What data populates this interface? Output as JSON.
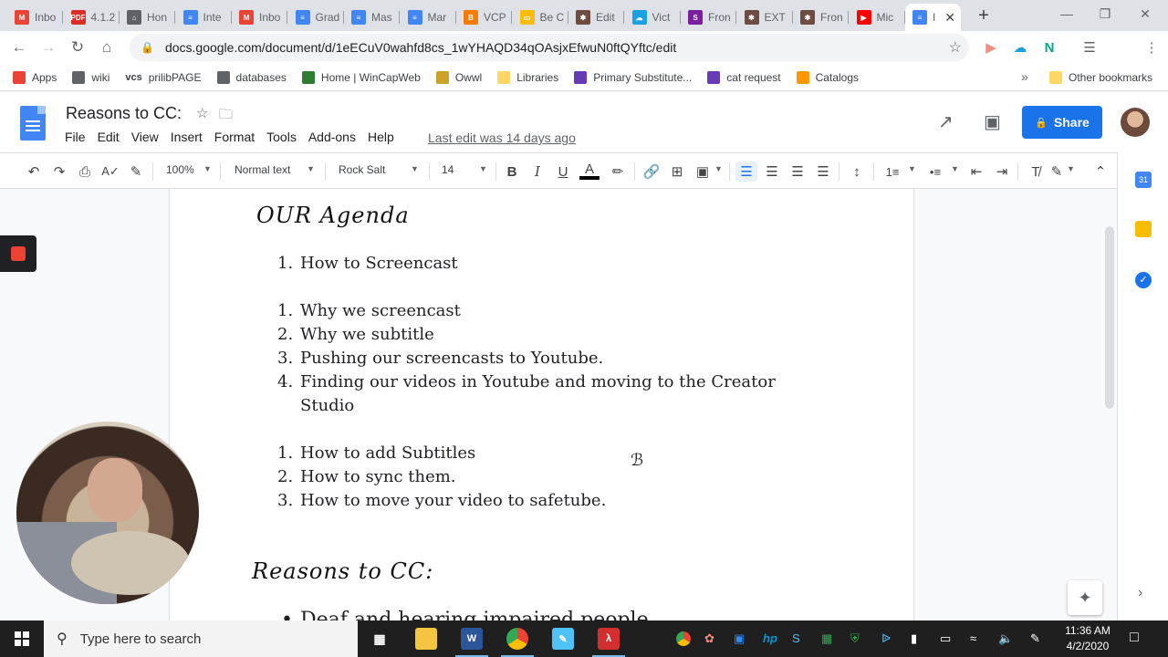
{
  "browser": {
    "tabs": [
      {
        "label": "Inbo",
        "color": "#ea4335",
        "glyph": "M"
      },
      {
        "label": "4.1.2",
        "color": "#d93025",
        "glyph": "PDF"
      },
      {
        "label": "Hon",
        "color": "#5f6368",
        "glyph": "⌂"
      },
      {
        "label": "Inte",
        "color": "#4285f4",
        "glyph": "≡"
      },
      {
        "label": "Inbo",
        "color": "#ea4335",
        "glyph": "M"
      },
      {
        "label": "Grad",
        "color": "#4285f4",
        "glyph": "≡"
      },
      {
        "label": "Mas",
        "color": "#4285f4",
        "glyph": "≡"
      },
      {
        "label": "Mar",
        "color": "#4285f4",
        "glyph": "≡"
      },
      {
        "label": "VCP",
        "color": "#f57c00",
        "glyph": "B"
      },
      {
        "label": "Be C",
        "color": "#fbbc04",
        "glyph": "▭"
      },
      {
        "label": "Edit",
        "color": "#6d4c41",
        "glyph": "✱"
      },
      {
        "label": "Vict",
        "color": "#1ba1e2",
        "glyph": "☁"
      },
      {
        "label": "Fron",
        "color": "#7b1fa2",
        "glyph": "S"
      },
      {
        "label": "EXT",
        "color": "#6d4c41",
        "glyph": "✱"
      },
      {
        "label": "Fron",
        "color": "#6d4c41",
        "glyph": "✱"
      },
      {
        "label": "Mic",
        "color": "#ff0000",
        "glyph": "▶"
      },
      {
        "label": "I",
        "color": "#4285f4",
        "glyph": "≡",
        "active": true
      }
    ],
    "new_tab": "+",
    "close_glyph": "✕",
    "url": "docs.google.com/document/d/1eECuV0wahfd8cs_1wYHAQD34qOAsjxEfwuN0ftQYftc/edit",
    "window_controls": [
      "—",
      "❐",
      "✕"
    ],
    "bookmarks": [
      {
        "label": "Apps",
        "color": "#ea4335"
      },
      {
        "label": "wiki",
        "color": "#5f6368"
      },
      {
        "label": "prilibPAGE",
        "color": "#3c4043",
        "prefix": "vcs"
      },
      {
        "label": "databases",
        "color": "#5f6368"
      },
      {
        "label": "Home | WinCapWeb",
        "color": "#2e7d32"
      },
      {
        "label": "Owwl",
        "color": "#c9a227"
      },
      {
        "label": "Libraries",
        "color": "#fdd663"
      },
      {
        "label": "Primary Substitute...",
        "color": "#673ab7"
      },
      {
        "label": "cat request",
        "color": "#673ab7"
      },
      {
        "label": "Catalogs",
        "color": "#ff9800"
      }
    ],
    "bookmarks_more": "»",
    "other_bookmarks": "Other bookmarks"
  },
  "docs": {
    "title": "Reasons to CC:",
    "menu": [
      "File",
      "Edit",
      "View",
      "Insert",
      "Format",
      "Tools",
      "Add-ons",
      "Help"
    ],
    "last_edit": "Last edit was 14 days ago",
    "share_label": "Share",
    "toolbar": {
      "zoom": "100%",
      "style": "Normal text",
      "font": "Rock Salt",
      "size": "14"
    }
  },
  "document": {
    "heading1": "OUR Agenda",
    "list1": [
      "How to Screencast"
    ],
    "list2": [
      "Why we screencast",
      "Why we subtitle",
      "Pushing our screencasts to Youtube.",
      "Finding our videos in Youtube and moving to the Creator",
      "Studio"
    ],
    "list3": [
      "How to add Subtitles",
      "How to sync them.",
      "How to move your video to safetube."
    ],
    "heading2": "Reasons to CC:",
    "bullet_partial": "Deaf and hearing impaired people"
  },
  "taskbar": {
    "search_placeholder": "Type here to search",
    "time": "11:36 AM",
    "date": "4/2/2020"
  }
}
